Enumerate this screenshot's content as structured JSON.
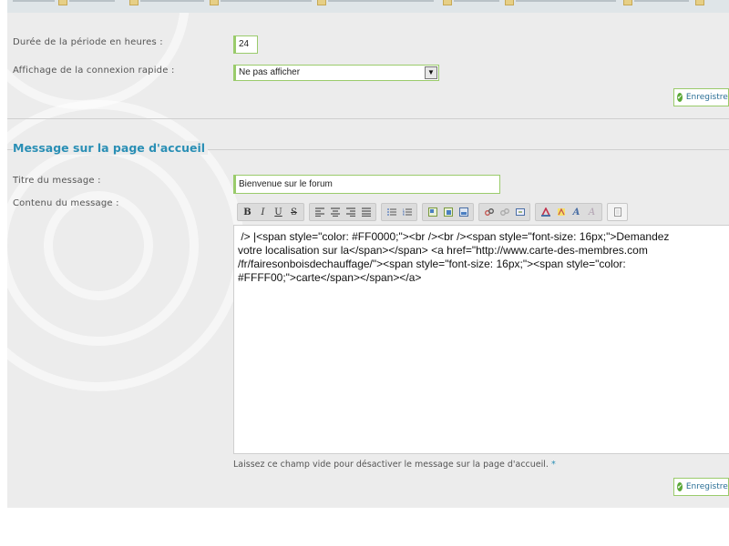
{
  "form": {
    "period_label": "Durée de la période en heures :",
    "period_value": "24",
    "quick_login_label": "Affichage de la connexion rapide :",
    "quick_login_value": "Ne pas afficher",
    "save_label": "Enregistrer"
  },
  "homepage_message": {
    "section_title": "Message sur la page d'accueil",
    "title_label": "Titre du message :",
    "title_value": "Bienvenue sur le forum",
    "content_label": "Contenu du message :",
    "content_lines": [
      " /> |<span style=\"color: #FF0000;\"><br /><br /><span style=\"font-size: 16px;\">Demandez",
      "votre localisation sur la</span></span> <a href=\"http://www.carte-des-membres.com",
      "/fr/fairesonboisdechauffage/\"><span style=\"font-size: 16px;\"><span style=\"color:",
      "#FFFF00;\">carte</span></span></a>"
    ],
    "hint": "Laissez ce champ vide pour désactiver le message sur la page d'accueil.",
    "hint_star": "*",
    "save_label": "Enregistrer"
  },
  "toolbar": {
    "bold": "B",
    "italic": "I",
    "underline": "U",
    "strike": "S"
  },
  "colors": {
    "accent": "#2a8fb5",
    "field_border": "#9acb6b",
    "panel_bg": "#ececec"
  }
}
